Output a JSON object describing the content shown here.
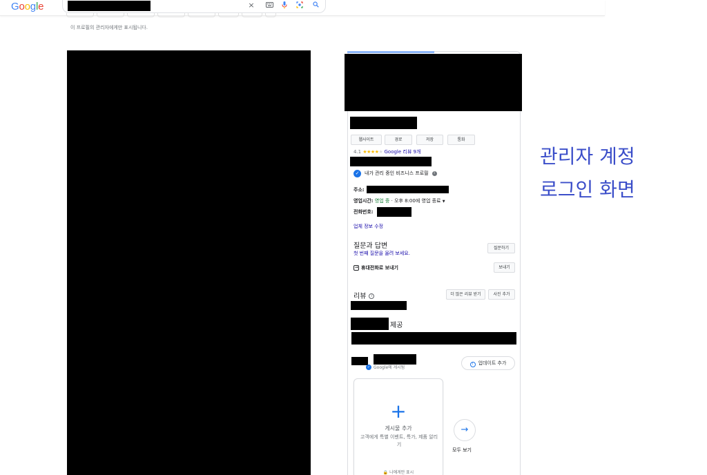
{
  "header": {
    "logo_letters": [
      "G",
      "o",
      "o",
      "g",
      "l",
      "e"
    ],
    "clear_icon": "×",
    "owner_note": "이 프로필의 관리자에게만 표시됩니다."
  },
  "panel": {
    "actions": [
      "웹사이트",
      "경로",
      "저장",
      "통화"
    ],
    "rating": {
      "score": "4.1",
      "stars_filled": "★★★★",
      "stars_empty": "★",
      "reviews_link": "Google 리뷰 9개"
    },
    "verified_label": "내가 관리 중인 비즈니스 프로필",
    "fields": {
      "address_label": "주소:",
      "hours_label": "영업시간:",
      "hours_open": "영업 중",
      "hours_rest": " · 오후 8:00에 영업 종료",
      "phone_label": "전화번호:"
    },
    "edit_link": "업체 정보 수정",
    "qa": {
      "title": "질문과 답변",
      "first_question_link": "첫 번째 질문을 올려 보세요.",
      "ask_button": "질문하기"
    },
    "send_to_phone": {
      "label": "휴대전화로 보내기",
      "button": "보내기"
    },
    "reviews": {
      "title": "리뷰",
      "get_more_button": "더 많은 리뷰 받기",
      "add_photo_button": "사진 추가",
      "provided_suffix": "제공"
    },
    "updates": {
      "add_update_button": "업데이트 추가",
      "posted_on": "Google에 게시됨"
    },
    "post_card": {
      "plus": "+",
      "title": "게시물 추가",
      "desc": "고객에게 특별 이벤트, 특가, 제품 알리기",
      "footer": "나에게만 표시"
    },
    "see_all": {
      "arrow": "→",
      "label": "모두 보기"
    }
  },
  "annotation": {
    "line1": "관리자 계정",
    "line2": "로그인 화면"
  },
  "colors": {
    "annotation": "#3b4ec9",
    "link": "#1a0dab",
    "open_status": "#188038",
    "star": "#fbbc04",
    "accent_blue": "#1a73e8"
  }
}
